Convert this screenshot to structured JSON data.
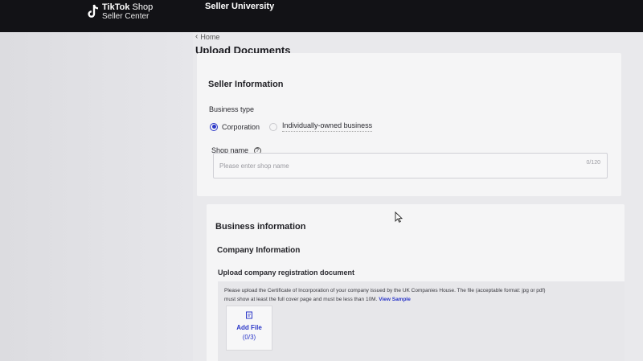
{
  "header": {
    "brand_line1": "TikTok",
    "brand_line1_suffix": "Shop",
    "brand_line2": "Seller Center",
    "nav_item": "Seller University"
  },
  "breadcrumb": {
    "home": "Home"
  },
  "page_title": "Upload Documents",
  "seller_info": {
    "title": "Seller Information",
    "business_type_label": "Business type",
    "options": [
      {
        "label": "Corporation",
        "selected": true
      },
      {
        "label": "Individually-owned business",
        "selected": false
      }
    ],
    "shop_name_label": "Shop name",
    "shop_name_placeholder": "Please enter shop name",
    "shop_name_counter": "0/120"
  },
  "business_info": {
    "title": "Business information",
    "company_title": "Company Information",
    "upload_label": "Upload company registration document",
    "upload_desc_line1": "Please upload the Certificate of Incorporation of your company issued by the UK Companies House. The file (acceptable format: jpg or pdf)",
    "upload_desc_line2": "must show at least the full cover page and must be less than 10M.",
    "view_sample": "View Sample",
    "add_file_label": "Add File",
    "add_file_count": "(0/3)"
  },
  "colors": {
    "accent": "#2b37c8",
    "topbar": "#121216"
  },
  "icons": {
    "logo": "tiktok-logo-icon",
    "back": "chevron-left-icon",
    "help": "question-circle-icon",
    "file": "file-icon",
    "cursor": "mouse-pointer-icon"
  }
}
